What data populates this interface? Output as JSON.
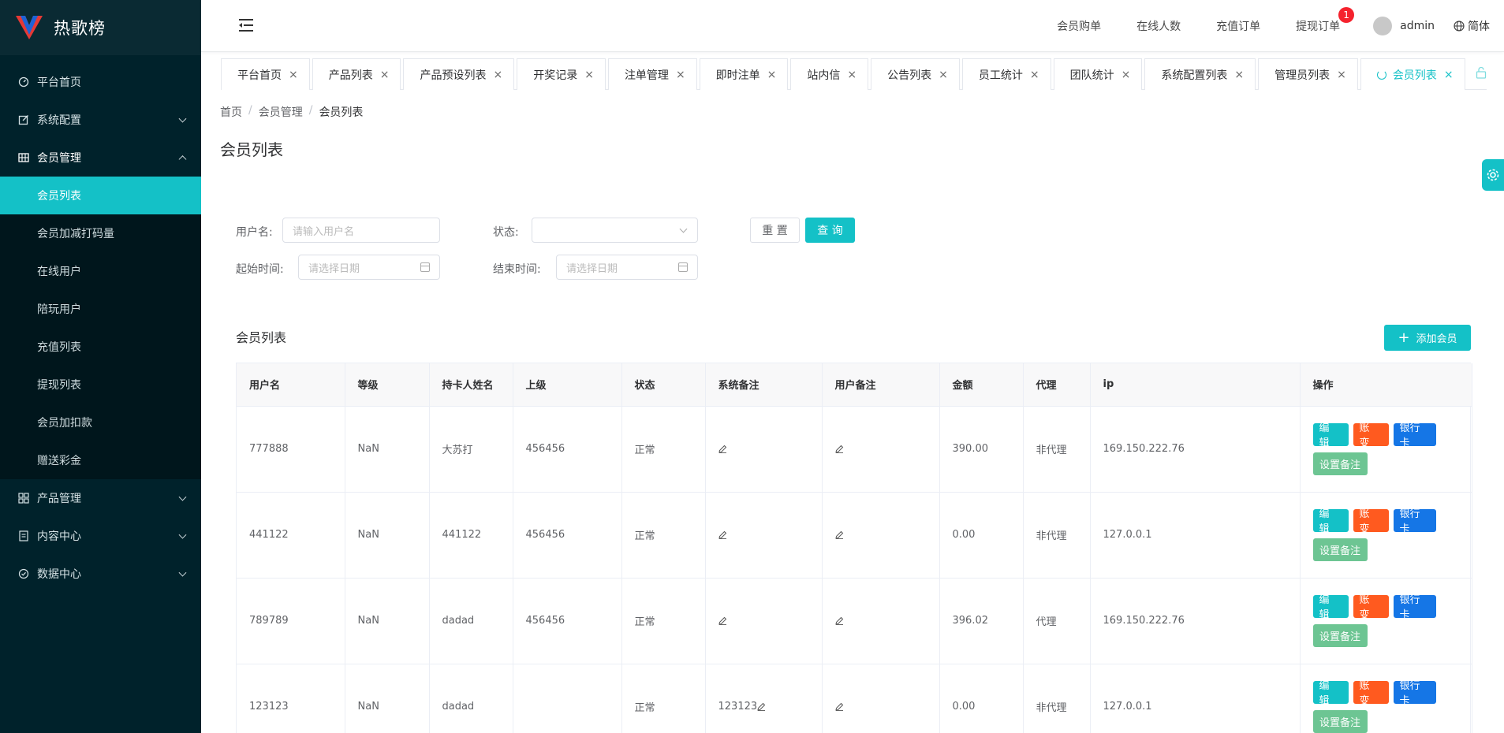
{
  "app": {
    "title": "热歌榜"
  },
  "sidebar": {
    "items": [
      {
        "label": "平台首页",
        "icon": "dashboard-icon"
      },
      {
        "label": "系统配置",
        "icon": "edit-square-icon"
      },
      {
        "label": "会员管理",
        "icon": "table-icon",
        "open": true,
        "children": [
          "会员列表",
          "会员加减打码量",
          "在线用户",
          "陪玩用户",
          "充值列表",
          "提现列表",
          "会员加扣款",
          "赠送彩金"
        ],
        "active_child": "会员列表"
      },
      {
        "label": "产品管理",
        "icon": "grid-icon"
      },
      {
        "label": "内容中心",
        "icon": "document-icon"
      },
      {
        "label": "数据中心",
        "icon": "check-circle-icon"
      }
    ]
  },
  "header": {
    "links": [
      "会员购单",
      "在线人数",
      "充值订单",
      "提现订单"
    ],
    "withdraw_badge": "1",
    "username": "admin",
    "language": "简体"
  },
  "tabs": [
    "平台首页",
    "产品列表",
    "产品预设列表",
    "开奖记录",
    "注单管理",
    "即时注单",
    "站内信",
    "公告列表",
    "员工统计",
    "团队统计",
    "系统配置列表",
    "管理员列表",
    "会员列表"
  ],
  "active_tab": "会员列表",
  "breadcrumb": [
    "首页",
    "会员管理",
    "会员列表"
  ],
  "page_title": "会员列表",
  "filters": {
    "username_label": "用户名:",
    "username_placeholder": "请输入用户名",
    "status_label": "状态:",
    "status_value": "",
    "reset_label": "重 置",
    "query_label": "查 询",
    "start_label": "起始时间:",
    "start_placeholder": "请选择日期",
    "end_label": "结束时间:",
    "end_placeholder": "请选择日期"
  },
  "table": {
    "title": "会员列表",
    "add_label": "添加会员",
    "columns": [
      "用户名",
      "等级",
      "持卡人姓名",
      "上级",
      "状态",
      "系统备注",
      "用户备注",
      "金额",
      "代理",
      "ip",
      "操作"
    ],
    "rows": [
      {
        "username": "777888",
        "level": "NaN",
        "holder": "大苏打",
        "parent": "456456",
        "status": "正常",
        "sys_note": "",
        "user_note": "",
        "amount": "390.00",
        "agent": "非代理",
        "ip": "169.150.222.76"
      },
      {
        "username": "441122",
        "level": "NaN",
        "holder": "441122",
        "parent": "456456",
        "status": "正常",
        "sys_note": "",
        "user_note": "",
        "amount": "0.00",
        "agent": "非代理",
        "ip": "127.0.0.1"
      },
      {
        "username": "789789",
        "level": "NaN",
        "holder": "dadad",
        "parent": "456456",
        "status": "正常",
        "sys_note": "",
        "user_note": "",
        "amount": "396.02",
        "agent": "代理",
        "ip": "169.150.222.76"
      },
      {
        "username": "123123",
        "level": "NaN",
        "holder": "dadad",
        "parent": "",
        "status": "正常",
        "sys_note": "123123",
        "user_note": "",
        "amount": "0.00",
        "agent": "非代理",
        "ip": "127.0.0.1"
      }
    ],
    "actions": {
      "edit": "编 辑",
      "account": "账 变",
      "bank": "银行卡",
      "note": "设置备注"
    }
  },
  "colors": {
    "accent": "#14c1c7",
    "sidebar": "#00222b",
    "orange": "#ff5a1f",
    "blue": "#1576e6",
    "green": "#6dc593"
  }
}
